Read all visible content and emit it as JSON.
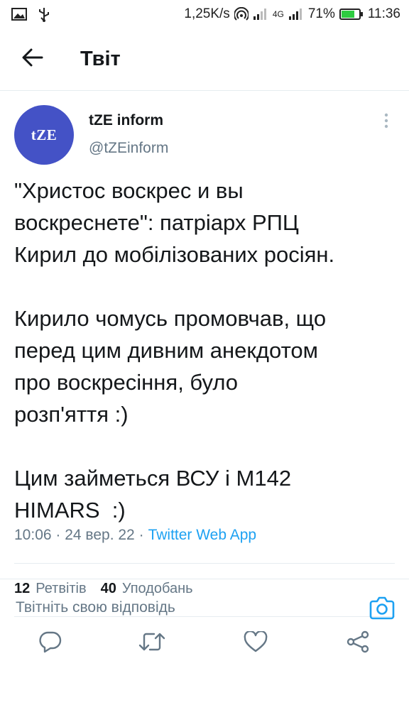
{
  "status_bar": {
    "speed": "1,25K/s",
    "network": "4G",
    "battery": "71%",
    "time": "11:36"
  },
  "header": {
    "title": "Твіт"
  },
  "tweet": {
    "avatar_text": "tZE",
    "name": "tZE inform",
    "handle": "@tZEinform",
    "text": "\"Христос воскрес и вы\nвоскреснете\": патріарх РПЦ\nКирил до мобілізованих росіян.\n\nКирило чомусь промовчав, що\nперед цим дивним анекдотом\nпро воскресіння, було\nрозп'яття :)\n\nЦим займеться ВСУ і M142\nHIMARS  :)",
    "time": "10:06",
    "date": "24 вер. 22",
    "source": "Twitter Web App",
    "retweets_count": "12",
    "retweets_label": "Ретвітів",
    "likes_count": "40",
    "likes_label": "Уподобань"
  },
  "reply": {
    "placeholder": "Твітніть свою відповідь"
  },
  "colors": {
    "accent": "#1da1f2",
    "avatar_bg": "#4452c6",
    "secondary_text": "#657786",
    "battery": "#2ecc40"
  },
  "icons": [
    "image-icon",
    "usb-icon",
    "hotspot-icon",
    "signal-icon",
    "battery-icon",
    "back-arrow-icon",
    "more-vertical-icon",
    "reply-icon",
    "retweet-icon",
    "like-icon",
    "share-icon",
    "camera-icon"
  ]
}
